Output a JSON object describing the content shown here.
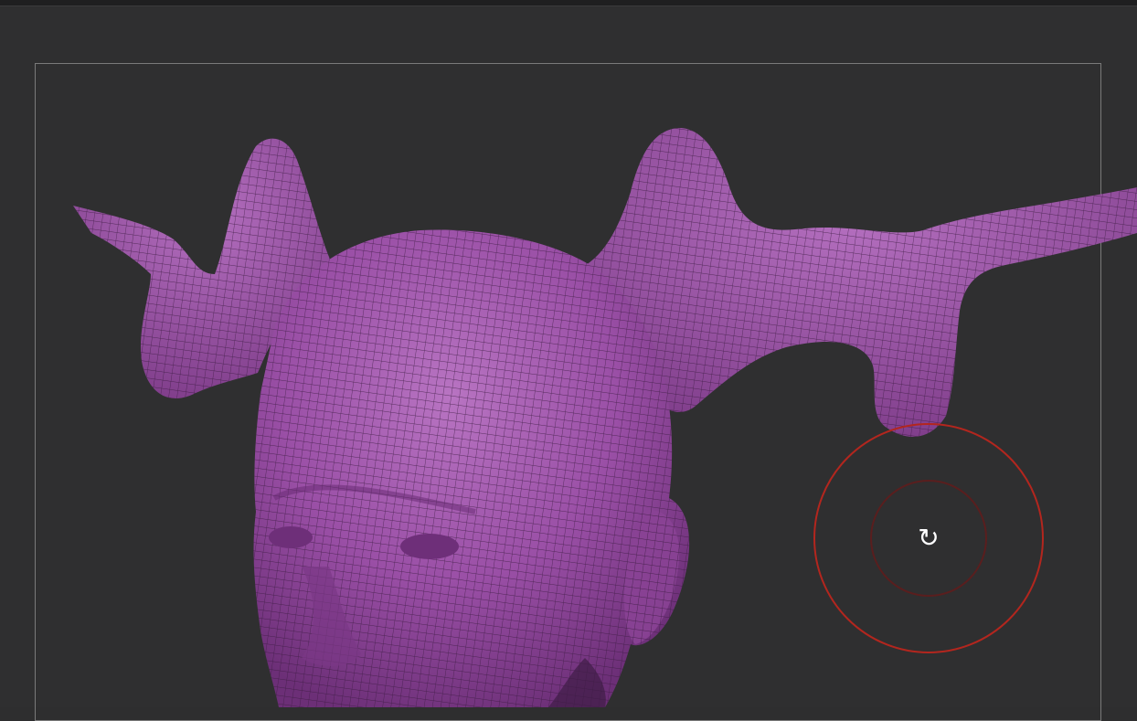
{
  "app": {
    "canvas_background": "#2f2f30",
    "frame_color": "#7a7a7a"
  },
  "model": {
    "mesh_color": "#9a4fa6",
    "mesh_highlight": "#c27bcb",
    "wire_color": "#3a1a40",
    "icon": "demon-head-mesh"
  },
  "brush_cursor": {
    "icon": "rotate-icon",
    "ring_color": "#b3261e",
    "inner_ring_color": "#5a1e1e",
    "glyph": "↻"
  }
}
